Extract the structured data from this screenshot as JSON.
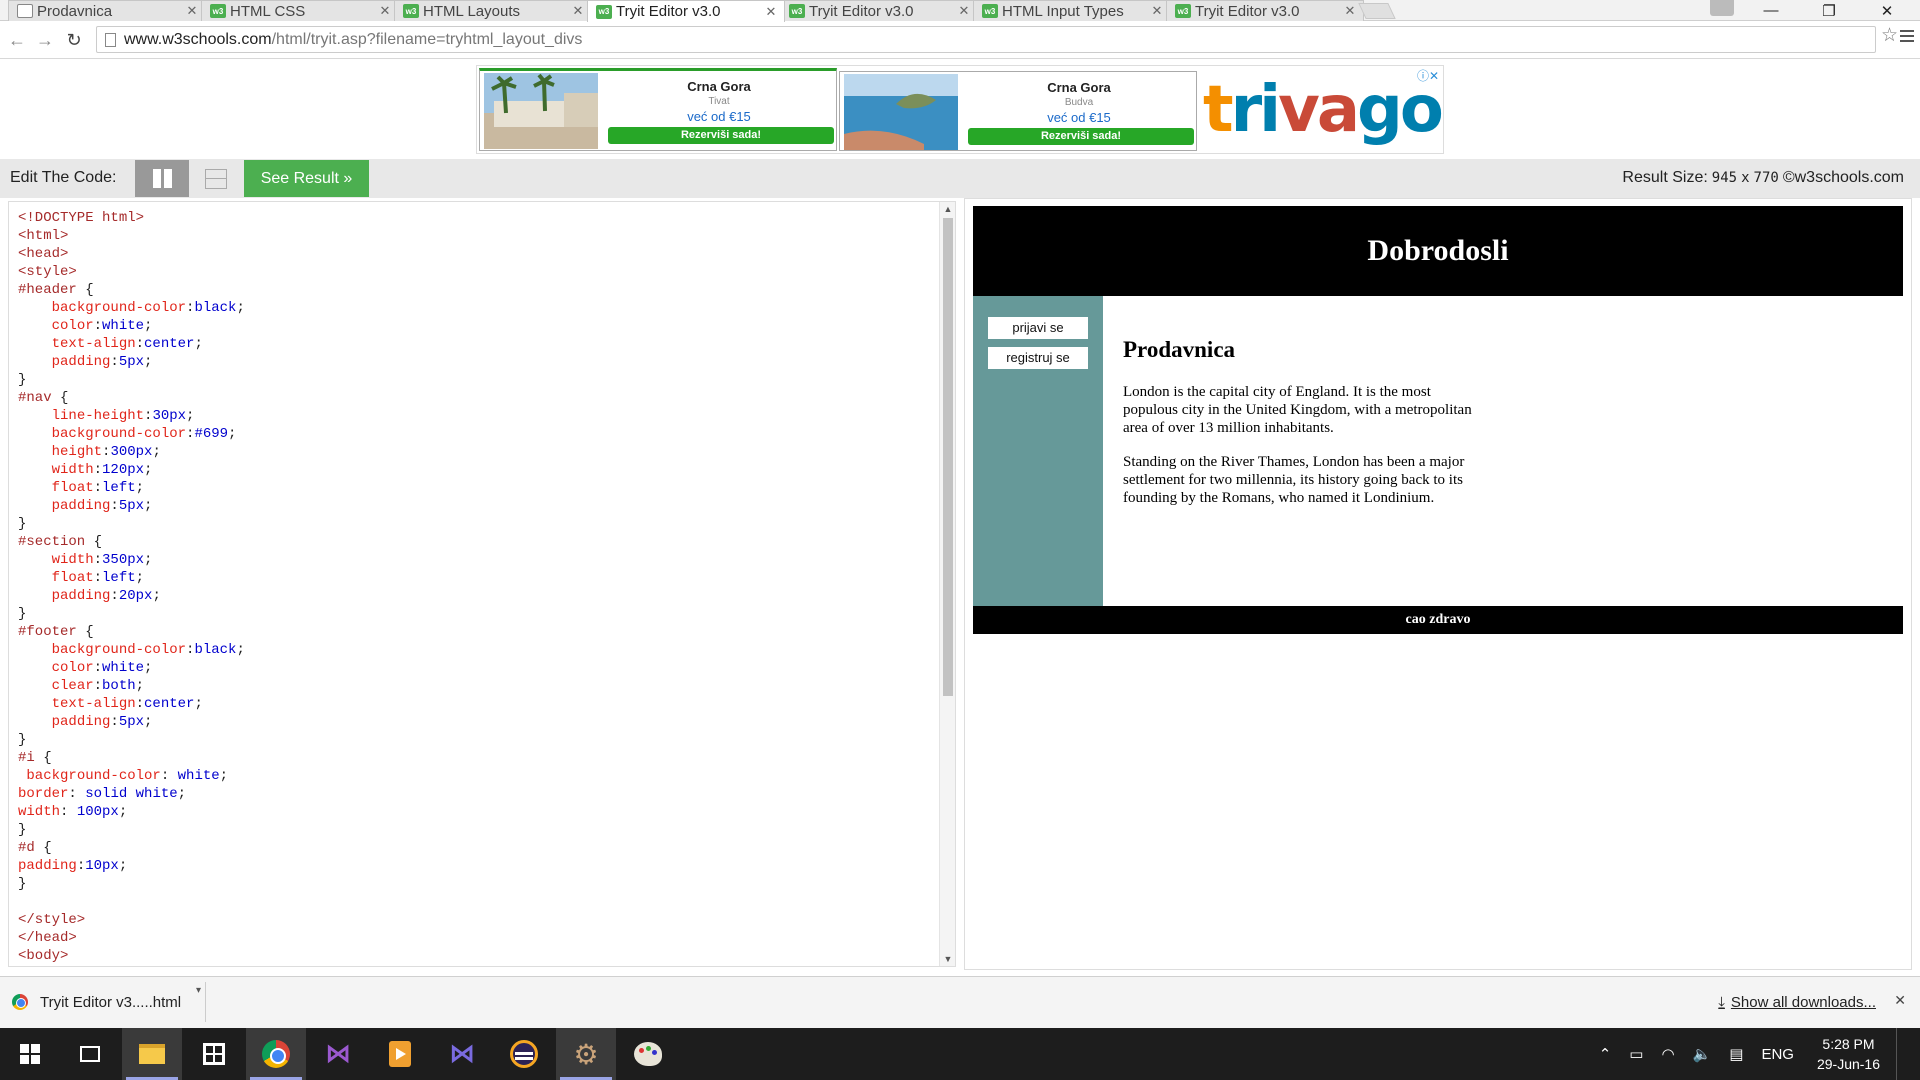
{
  "browser": {
    "tabs": [
      {
        "label": "Prodavnica",
        "icon": "page-icon",
        "active": false
      },
      {
        "label": "HTML CSS",
        "icon": "w3schools-icon",
        "active": false
      },
      {
        "label": "HTML Layouts",
        "icon": "w3schools-icon",
        "active": false
      },
      {
        "label": "Tryit Editor v3.0",
        "icon": "w3schools-icon",
        "active": true
      },
      {
        "label": "Tryit Editor v3.0",
        "icon": "w3schools-icon",
        "active": false
      },
      {
        "label": "HTML Input Types",
        "icon": "w3schools-icon",
        "active": false
      },
      {
        "label": "Tryit Editor v3.0",
        "icon": "w3schools-icon",
        "active": false
      }
    ],
    "url_host": "www.w3schools.com",
    "url_path": "/html/tryit.asp?filename=tryhtml_layout_divs",
    "w3_icon_text": "w3"
  },
  "ad": {
    "hotels": [
      {
        "name": "Crna Gora",
        "city": "Tivat",
        "price": "već od €15",
        "button": "Rezerviši sada!"
      },
      {
        "name": "Crna Gora",
        "city": "Budva",
        "price": "već od €15",
        "button": "Rezerviši sada!"
      }
    ],
    "brand": "trivago",
    "brand_colors": {
      "t": "#f48f00",
      "ri": "#007fae",
      "va": "#c94a38",
      "go": "#007fae"
    },
    "brand_parts": [
      "tri",
      "va",
      "go"
    ]
  },
  "editor": {
    "label": "Edit The Code:",
    "see_result": "See Result »",
    "result_size_label": "Result Size:",
    "result_w": "945",
    "result_x": "x",
    "result_h": "770",
    "copyright": "©w3schools.com"
  },
  "code_lines": [
    [
      [
        "tg",
        "<!DOCTYPE html>"
      ]
    ],
    [
      [
        "tg",
        "<html>"
      ]
    ],
    [
      [
        "tg",
        "<head>"
      ]
    ],
    [
      [
        "tg",
        "<style>"
      ]
    ],
    [
      [
        "sel",
        "#header "
      ],
      [
        "pn",
        "{"
      ]
    ],
    [
      [
        "pn",
        "    "
      ],
      [
        "pr",
        "background-color"
      ],
      [
        "pn",
        ":"
      ],
      [
        "vl",
        "black"
      ],
      [
        "pn",
        ";"
      ]
    ],
    [
      [
        "pn",
        "    "
      ],
      [
        "pr",
        "color"
      ],
      [
        "pn",
        ":"
      ],
      [
        "vl",
        "white"
      ],
      [
        "pn",
        ";"
      ]
    ],
    [
      [
        "pn",
        "    "
      ],
      [
        "pr",
        "text-align"
      ],
      [
        "pn",
        ":"
      ],
      [
        "vl",
        "center"
      ],
      [
        "pn",
        ";"
      ]
    ],
    [
      [
        "pn",
        "    "
      ],
      [
        "pr",
        "padding"
      ],
      [
        "pn",
        ":"
      ],
      [
        "vl",
        "5px"
      ],
      [
        "pn",
        ";"
      ]
    ],
    [
      [
        "pn",
        "}"
      ]
    ],
    [
      [
        "sel",
        "#nav "
      ],
      [
        "pn",
        "{"
      ]
    ],
    [
      [
        "pn",
        "    "
      ],
      [
        "pr",
        "line-height"
      ],
      [
        "pn",
        ":"
      ],
      [
        "vl",
        "30px"
      ],
      [
        "pn",
        ";"
      ]
    ],
    [
      [
        "pn",
        "    "
      ],
      [
        "pr",
        "background-color"
      ],
      [
        "pn",
        ":"
      ],
      [
        "vl",
        "#699"
      ],
      [
        "pn",
        ";"
      ]
    ],
    [
      [
        "pn",
        "    "
      ],
      [
        "pr",
        "height"
      ],
      [
        "pn",
        ":"
      ],
      [
        "vl",
        "300px"
      ],
      [
        "pn",
        ";"
      ]
    ],
    [
      [
        "pn",
        "    "
      ],
      [
        "pr",
        "width"
      ],
      [
        "pn",
        ":"
      ],
      [
        "vl",
        "120px"
      ],
      [
        "pn",
        ";"
      ]
    ],
    [
      [
        "pn",
        "    "
      ],
      [
        "pr",
        "float"
      ],
      [
        "pn",
        ":"
      ],
      [
        "vl",
        "left"
      ],
      [
        "pn",
        ";"
      ]
    ],
    [
      [
        "pn",
        "    "
      ],
      [
        "pr",
        "padding"
      ],
      [
        "pn",
        ":"
      ],
      [
        "vl",
        "5px"
      ],
      [
        "pn",
        ";"
      ]
    ],
    [
      [
        "pn",
        "}"
      ]
    ],
    [
      [
        "sel",
        "#section "
      ],
      [
        "pn",
        "{"
      ]
    ],
    [
      [
        "pn",
        "    "
      ],
      [
        "pr",
        "width"
      ],
      [
        "pn",
        ":"
      ],
      [
        "vl",
        "350px"
      ],
      [
        "pn",
        ";"
      ]
    ],
    [
      [
        "pn",
        "    "
      ],
      [
        "pr",
        "float"
      ],
      [
        "pn",
        ":"
      ],
      [
        "vl",
        "left"
      ],
      [
        "pn",
        ";"
      ]
    ],
    [
      [
        "pn",
        "    "
      ],
      [
        "pr",
        "padding"
      ],
      [
        "pn",
        ":"
      ],
      [
        "vl",
        "20px"
      ],
      [
        "pn",
        ";"
      ]
    ],
    [
      [
        "pn",
        "}"
      ]
    ],
    [
      [
        "sel",
        "#footer "
      ],
      [
        "pn",
        "{"
      ]
    ],
    [
      [
        "pn",
        "    "
      ],
      [
        "pr",
        "background-color"
      ],
      [
        "pn",
        ":"
      ],
      [
        "vl",
        "black"
      ],
      [
        "pn",
        ";"
      ]
    ],
    [
      [
        "pn",
        "    "
      ],
      [
        "pr",
        "color"
      ],
      [
        "pn",
        ":"
      ],
      [
        "vl",
        "white"
      ],
      [
        "pn",
        ";"
      ]
    ],
    [
      [
        "pn",
        "    "
      ],
      [
        "pr",
        "clear"
      ],
      [
        "pn",
        ":"
      ],
      [
        "vl",
        "both"
      ],
      [
        "pn",
        ";"
      ]
    ],
    [
      [
        "pn",
        "    "
      ],
      [
        "pr",
        "text-align"
      ],
      [
        "pn",
        ":"
      ],
      [
        "vl",
        "center"
      ],
      [
        "pn",
        ";"
      ]
    ],
    [
      [
        "pn",
        "    "
      ],
      [
        "pr",
        "padding"
      ],
      [
        "pn",
        ":"
      ],
      [
        "vl",
        "5px"
      ],
      [
        "pn",
        ";"
      ]
    ],
    [
      [
        "pn",
        "}"
      ]
    ],
    [
      [
        "sel",
        "#i "
      ],
      [
        "pn",
        "{"
      ]
    ],
    [
      [
        "pn",
        " "
      ],
      [
        "pr",
        "background-color"
      ],
      [
        "pn",
        ": "
      ],
      [
        "vl",
        "white"
      ],
      [
        "pn",
        ";"
      ]
    ],
    [
      [
        "pr",
        "border"
      ],
      [
        "pn",
        ": "
      ],
      [
        "vl",
        "solid white"
      ],
      [
        "pn",
        ";"
      ]
    ],
    [
      [
        "pr",
        "width"
      ],
      [
        "pn",
        ": "
      ],
      [
        "vl",
        "100px"
      ],
      [
        "pn",
        ";"
      ]
    ],
    [
      [
        "pn",
        "}"
      ]
    ],
    [
      [
        "sel",
        "#d "
      ],
      [
        "pn",
        "{"
      ]
    ],
    [
      [
        "pr",
        "padding"
      ],
      [
        "pn",
        ":"
      ],
      [
        "vl",
        "10px"
      ],
      [
        "pn",
        ";"
      ]
    ],
    [
      [
        "pn",
        "}"
      ]
    ],
    [
      [
        "pn",
        ""
      ]
    ],
    [
      [
        "tg",
        "</style>"
      ]
    ],
    [
      [
        "tg",
        "</head>"
      ]
    ],
    [
      [
        "tg",
        "<body>"
      ]
    ]
  ],
  "result": {
    "header": "Dobrodosli",
    "nav_buttons": [
      "prijavi se",
      "registruj se"
    ],
    "section_title": "Prodavnica",
    "paragraphs": [
      "London is the capital city of England. It is the most populous city in the United Kingdom, with a metropolitan area of over 13 million inhabitants.",
      "Standing on the River Thames, London has been a major settlement for two millennia, its history going back to its founding by the Romans, who named it Londinium."
    ],
    "footer": "cao zdravo",
    "nav_color": "#669999"
  },
  "downloads": {
    "item": "Tryit Editor v3.....html",
    "show_all": "Show all downloads..."
  },
  "taskbar": {
    "tray_language": "ENG",
    "time": "5:28 PM",
    "date": "29-Jun-16"
  }
}
